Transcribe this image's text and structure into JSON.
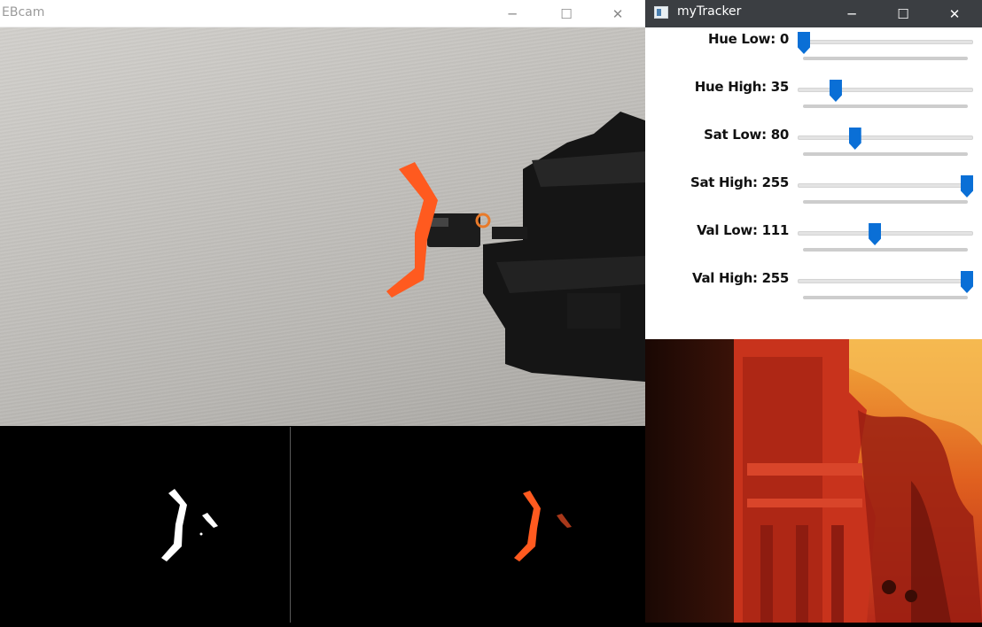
{
  "cam_window": {
    "title": "EBcam",
    "min_glyph": "─",
    "max_glyph": "☐",
    "close_glyph": "✕"
  },
  "tracker_window": {
    "title": "myTracker",
    "min_glyph": "─",
    "max_glyph": "☐",
    "close_glyph": "✕",
    "sliders": [
      {
        "label": "Hue Low: 0",
        "value": 0,
        "max": 179
      },
      {
        "label": "Hue High: 35",
        "value": 35,
        "max": 179
      },
      {
        "label": "Sat Low: 80",
        "value": 80,
        "max": 255
      },
      {
        "label": "Sat High: 255",
        "value": 255,
        "max": 255
      },
      {
        "label": "Val Low: 111",
        "value": 111,
        "max": 255
      },
      {
        "label": "Val High: 255",
        "value": 255,
        "max": 255
      }
    ]
  },
  "colors": {
    "accent": "#0a6fd6",
    "object": "#ff5a1f",
    "mask": "#ffffff"
  }
}
